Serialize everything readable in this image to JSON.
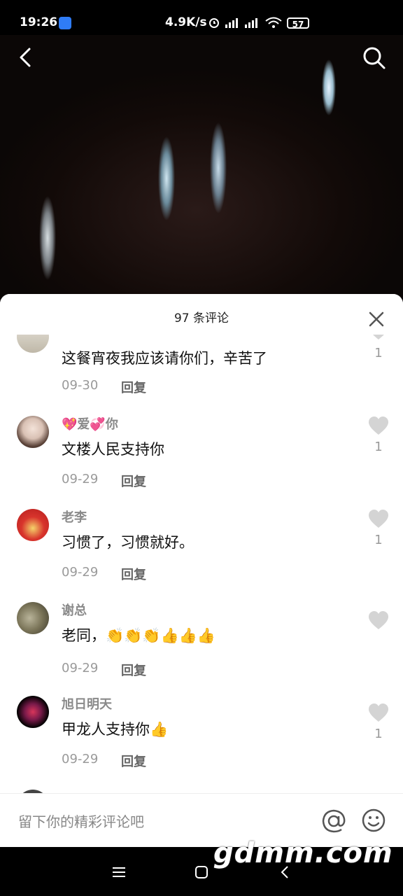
{
  "status_bar": {
    "time": "19:26",
    "speed": "4.9K/s",
    "battery": "57"
  },
  "header": {
    "comment_count_title": "97 条评论"
  },
  "comments": [
    {
      "username": "",
      "text": "这餐宵夜我应该请你们，辛苦了",
      "date": "09-30",
      "reply_label": "回复",
      "likes": "1"
    },
    {
      "username": "💖爱💞你",
      "text": "文楼人民支持你",
      "date": "09-29",
      "reply_label": "回复",
      "likes": "1"
    },
    {
      "username": "老李",
      "text": "习惯了，习惯就好。",
      "date": "09-29",
      "reply_label": "回复",
      "likes": "1"
    },
    {
      "username": "谢总",
      "text": "老同，👏👏👏👍👍👍",
      "date": "09-29",
      "reply_label": "回复",
      "likes": ""
    },
    {
      "username": "旭日明天",
      "text": "甲龙人支持你👍",
      "date": "09-29",
      "reply_label": "回复",
      "likes": "1"
    }
  ],
  "input": {
    "placeholder": "留下你的精彩评论吧"
  },
  "watermark": "gdmm.com",
  "icons": {
    "back": "back-arrow-icon",
    "search": "search-icon",
    "close": "close-icon",
    "like": "heart-icon",
    "at": "at-sign-icon",
    "emoji": "smiley-icon"
  }
}
